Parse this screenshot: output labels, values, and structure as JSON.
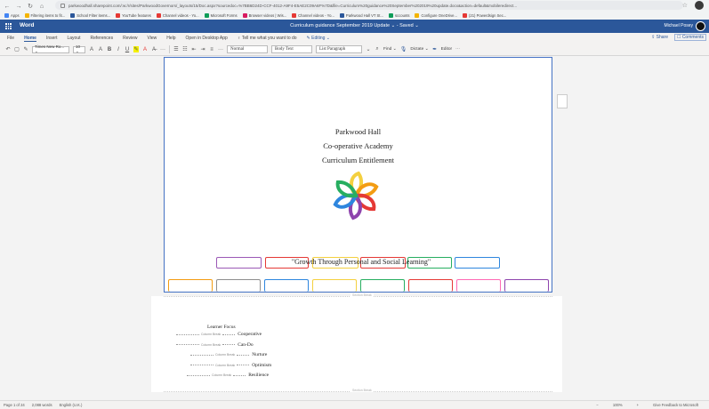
{
  "browser": {
    "url": "parkwoodhall.sharepoint.com/:w:/r/sites/ParkwoodGovernors/_layouts/15/Doc.aspx?sourcedoc=%7BB6D24D-CCF-4012-A9F4-E5AE2C09A6F%7D&file=Curriculum%20guidance%20September%202019%20update.docx&action=default&mobileredirect...",
    "bookmarks": [
      {
        "label": "Apps",
        "color": "#4285f4"
      },
      {
        "label": "Filtering items to fit...",
        "color": "#f4b400"
      },
      {
        "label": "School Filter items...",
        "color": "#2b579a"
      },
      {
        "label": "YouTube features",
        "color": "#e53935"
      },
      {
        "label": "Channel videos - Yo...",
        "color": "#e53935"
      },
      {
        "label": "Microsoft Forms",
        "color": "#0f9d58"
      },
      {
        "label": "Browser videos | Wis...",
        "color": "#d81b60"
      },
      {
        "label": "Channel videos - Yo...",
        "color": "#e53935"
      },
      {
        "label": "Parkwood Hall VT St...",
        "color": "#2b579a"
      },
      {
        "label": "sccounts",
        "color": "#0f9d58"
      },
      {
        "label": "Configure OneDrive...",
        "color": "#f4b400"
      },
      {
        "label": "(21) Powerdsign Sec...",
        "color": "#e53935"
      }
    ]
  },
  "word": {
    "app_name": "Word",
    "doc_title": "Curriculum guidance September 2019 Update ⌄ - Saved ⌄",
    "user_name": "Michael Posey"
  },
  "ribbon": {
    "tabs": [
      "File",
      "Home",
      "Insert",
      "Layout",
      "References",
      "Review",
      "View",
      "Help",
      "Open in Desktop App",
      "♀ Tell me what you want to do",
      "✎ Editing ⌄"
    ],
    "active_tab": "Home",
    "share_label": "⇪ Share",
    "comments_label": "☐ Comments"
  },
  "toolbar": {
    "font_name": "Times New Ro... ⌄",
    "font_size": "10 ⌄",
    "style_normal": "Normal",
    "style_body": "Body Text",
    "style_list": "List Paragraph",
    "find_label": "Find ⌄",
    "dictate_label": "Dictate ⌄",
    "editor_label": "Editor",
    "more_label": "···"
  },
  "document": {
    "title_lines": [
      "Parkwood Hall",
      "Co-operative Academy",
      "Curriculum Entitlement"
    ],
    "banner_text": "\"Growth Through Personal and Social Learning\"",
    "section_break_label": "Section Break",
    "learner_focus_title": "Learner Focus",
    "column_break_label": "Column Break",
    "focus_items": [
      "Cooperative",
      "Can-Do",
      "Nurture",
      "Optimism",
      "Resilience"
    ],
    "top_box_colors": [
      "#9b59b6",
      "#e53935",
      "#f4d03f",
      "#e53935",
      "#27ae60",
      "#2e86de"
    ],
    "bottom_box_colors": [
      "#f39c12",
      "#8e8e8e",
      "#2e86de",
      "#f4d03f",
      "#27ae60",
      "#e53935",
      "#ff69b4",
      "#8e44ad"
    ],
    "logo_colors": [
      "#f4d03f",
      "#f39c12",
      "#e53935",
      "#8e44ad",
      "#2e86de",
      "#27ae60"
    ]
  },
  "status": {
    "page_info": "Page 1 of 24",
    "word_count": "2,088 words",
    "language": "English (U.K.)",
    "zoom": "100%",
    "feedback": "Give Feedback to Microsoft"
  }
}
